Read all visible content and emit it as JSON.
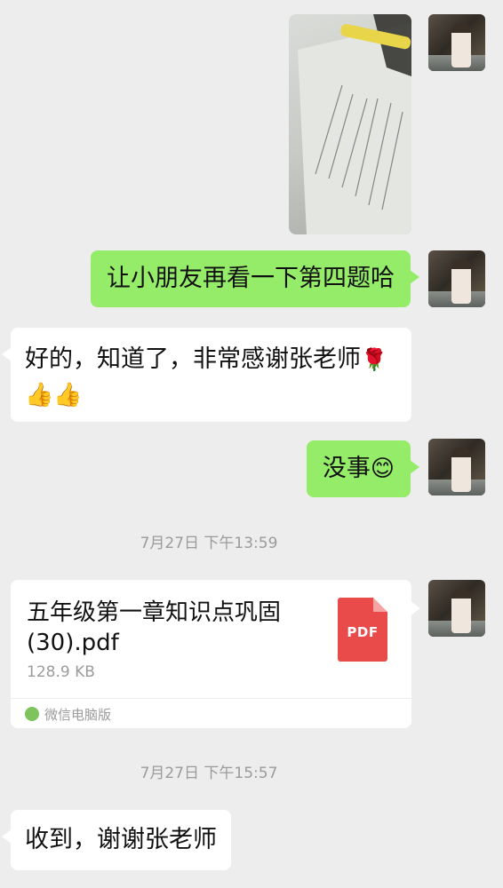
{
  "messages": {
    "photo_msg": {
      "type": "image",
      "from": "me"
    },
    "msg1": {
      "text": "让小朋友再看一下第四题哈"
    },
    "msg2": {
      "text_line1": "好的，知道了，非常感谢张老师",
      "emoji_rose": "🌹",
      "emoji_thumbs": "👍👍"
    },
    "msg3": {
      "text": "没事",
      "emoji_smile": "😊"
    },
    "time1": "7月27日 下午13:59",
    "file_msg": {
      "filename_line1": "五年级第一章知识点巩固",
      "filename_line2": "(30).pdf",
      "size": "128.9 KB",
      "file_type": "PDF",
      "source": "微信电脑版"
    },
    "time2": "7月27日 下午15:57",
    "msg4": {
      "text": "收到，谢谢张老师"
    }
  },
  "colors": {
    "background": "#ededed",
    "my_bubble": "#95ec69",
    "their_bubble": "#ffffff",
    "pdf": "#e94a4a"
  },
  "icons": [
    "avatar-photo",
    "pdf-file-icon",
    "pc-wechat-icon"
  ]
}
